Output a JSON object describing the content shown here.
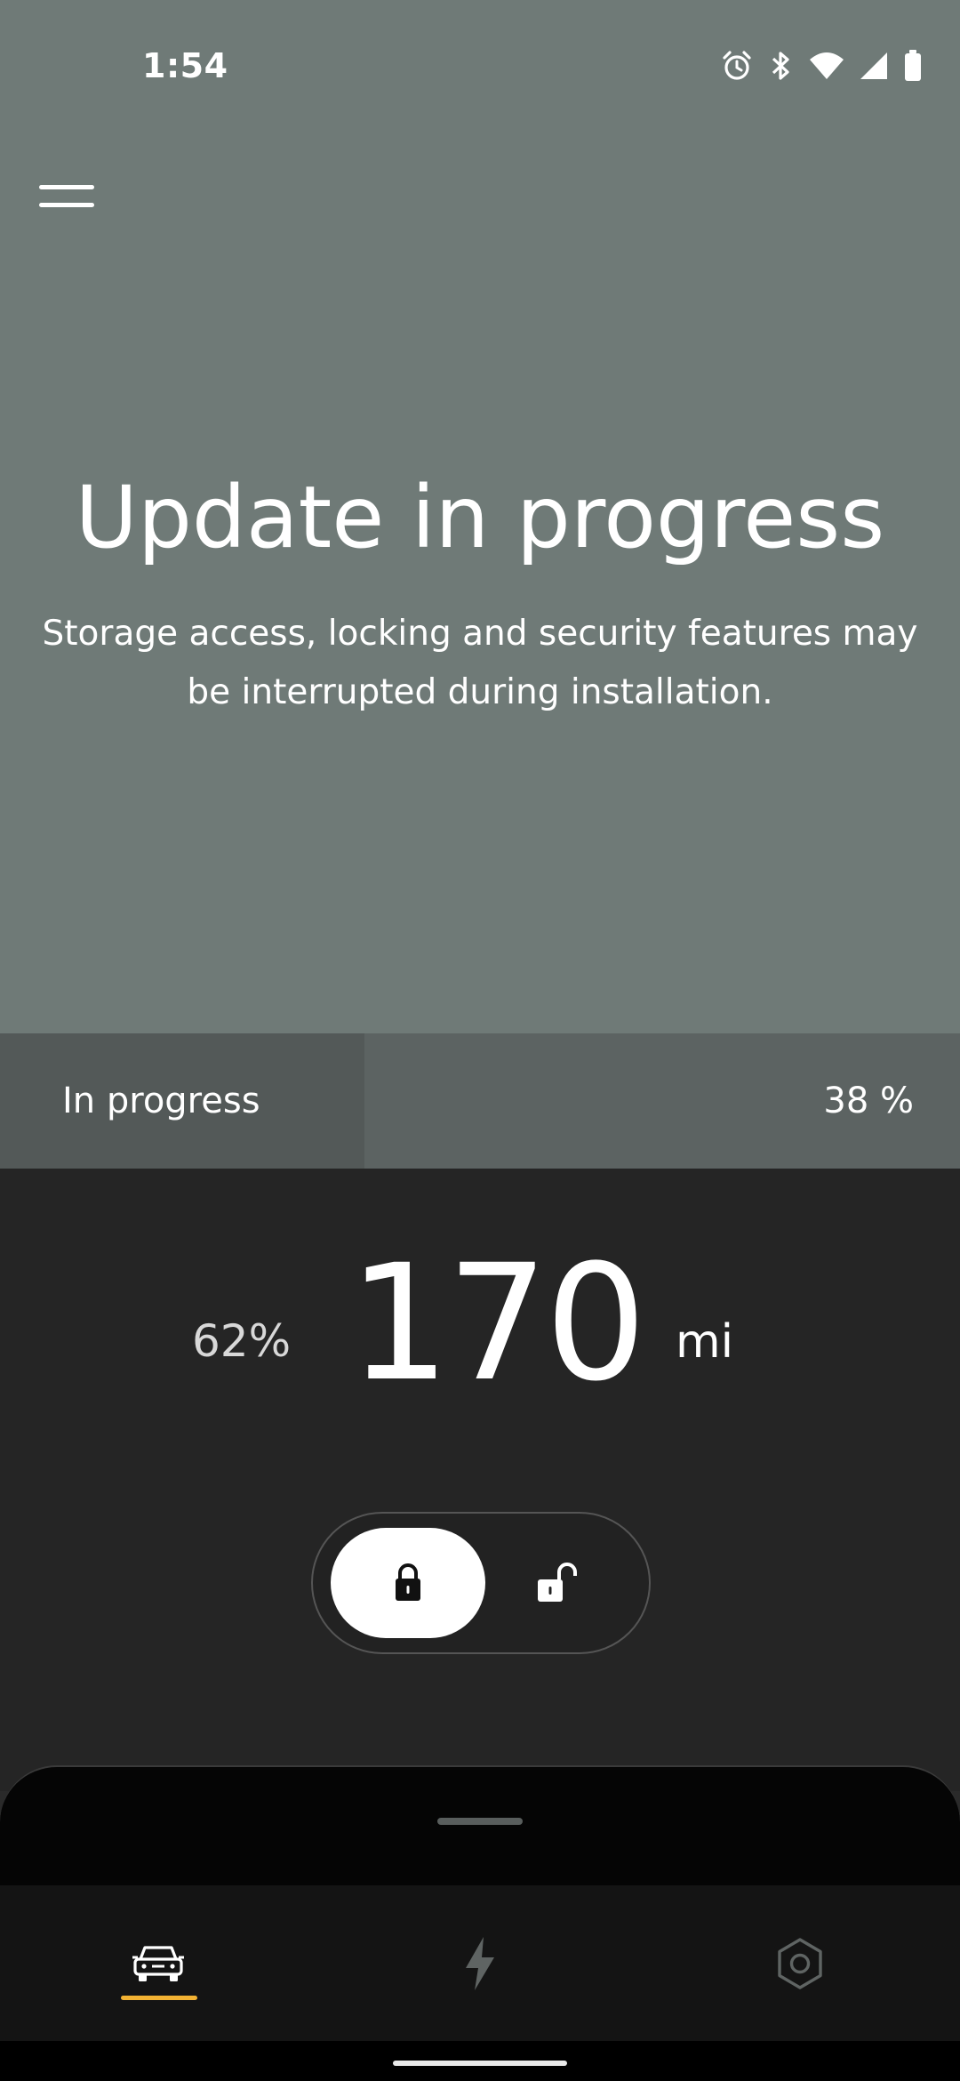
{
  "status_bar": {
    "time": "1:54"
  },
  "hero": {
    "title": "Update in progress",
    "subtitle": "Storage access, locking and security features may be interrupted during installation."
  },
  "update_progress": {
    "label": "In progress",
    "percent_text": "38 %",
    "value": 38
  },
  "vehicle": {
    "battery_percent": "62%",
    "range_value": "170",
    "range_unit": "mi",
    "lock_state": "locked"
  },
  "nav": {
    "items": [
      {
        "id": "vehicle",
        "icon": "car-icon",
        "active": true
      },
      {
        "id": "charging",
        "icon": "lightning-bolt-icon",
        "active": false
      },
      {
        "id": "settings",
        "icon": "hexagon-settings-icon",
        "active": false
      }
    ]
  },
  "colors": {
    "hero_bg": "#6f7a77",
    "progress_bg": "#5c6362",
    "progress_fill": "#535958",
    "panel_bg": "#252525",
    "nav_accent": "#f2b233"
  }
}
